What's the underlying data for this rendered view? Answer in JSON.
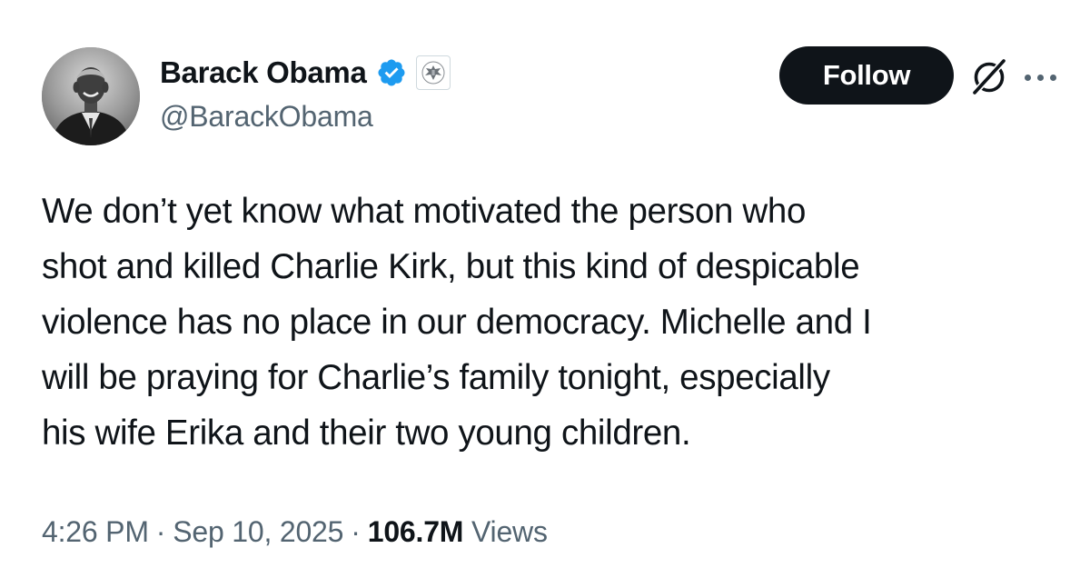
{
  "author": {
    "display_name": "Barack Obama",
    "handle": "@BarackObama",
    "verified": true,
    "verified_color": "#1d9bf0",
    "affiliate_badge": "government-seal-icon"
  },
  "actions": {
    "follow_label": "Follow",
    "grok_icon": "grok-icon",
    "more_icon": "more-icon"
  },
  "tweet": {
    "text_lines": [
      "We don’t yet know what motivated the person who",
      "shot and killed Charlie Kirk, but this kind of despicable",
      "violence has no place in our democracy. Michelle and I",
      "will be praying for Charlie’s family tonight, especially",
      "his wife Erika and their two young children."
    ]
  },
  "meta": {
    "time": "4:26 PM",
    "separator": "·",
    "date": "Sep 10, 2025",
    "views_count": "106.7M",
    "views_label": "Views"
  },
  "colors": {
    "text_primary": "#0f1419",
    "text_secondary": "#536471",
    "button_bg": "#0f1419",
    "background": "#ffffff"
  }
}
